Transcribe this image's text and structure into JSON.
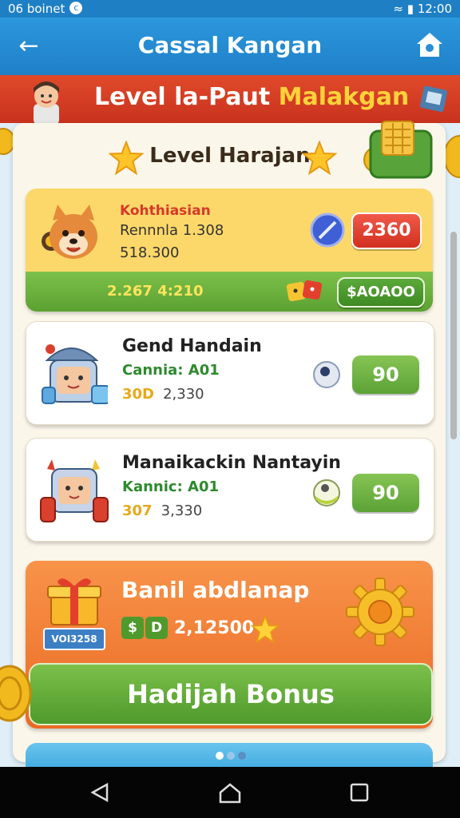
{
  "status": {
    "left_text": "06 boinet",
    "time": "12:00"
  },
  "header": {
    "title": "Cassal Kangan"
  },
  "banner": {
    "title_white": "Level la-Paut ",
    "title_yellow": "Malakgan"
  },
  "section": {
    "title": "Level Harajan"
  },
  "cards": [
    {
      "name": "Kohthiasian",
      "line2": "Rennnla 1.308",
      "line3": "518.300",
      "button": "2360",
      "footer_left": "2.267 4:210",
      "footer_button": "$AOAOO"
    },
    {
      "name": "Gend Handain",
      "line2": "Cannia: A01",
      "badge": "30D",
      "amount": "2,330",
      "button": "90"
    },
    {
      "name": "Manaikackin Nantayin",
      "line2": "Kannic: A01",
      "badge": "307",
      "amount": "3,330",
      "button": "90"
    }
  ],
  "bonus": {
    "title": "Banil abdlanap",
    "gift_label": "VOI3258",
    "chip1": "$",
    "chip2": "D",
    "amount": "2,12500",
    "button": "Hadijah Bonus"
  },
  "bottom_card": {
    "text": ""
  },
  "colors": {
    "appbar": "#2b97dc",
    "banner": "#d93b24",
    "accent_green": "#5ca236",
    "accent_red": "#d2301f",
    "bonus_orange": "#ef7a32"
  }
}
